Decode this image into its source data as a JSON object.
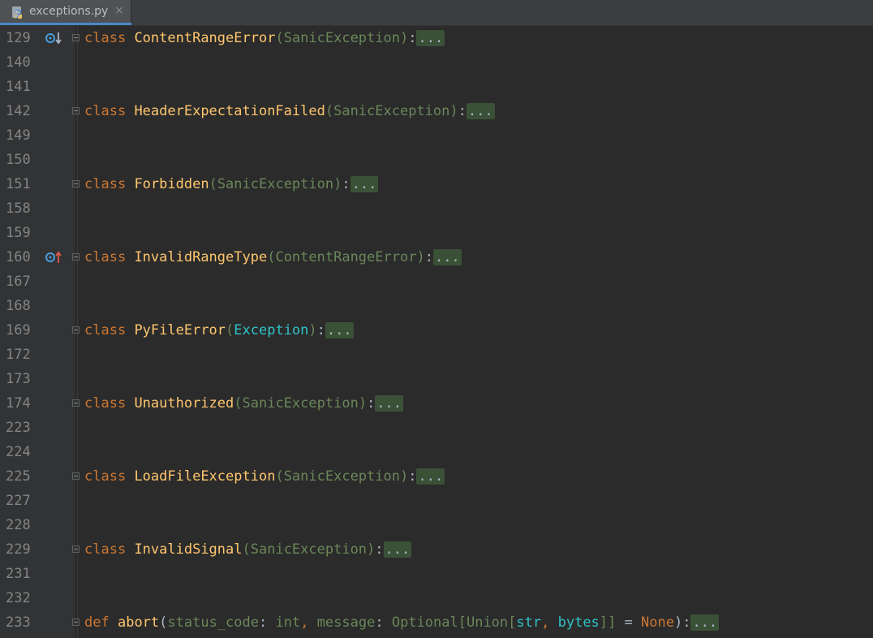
{
  "tab": {
    "filename": "exceptions.py",
    "icon": "python-file-icon",
    "close_glyph": "×"
  },
  "colors": {
    "background": "#2B2B2B",
    "gutter": "#313335",
    "keyword": "#CC7832",
    "class_name": "#FFC66D",
    "base_class": "#6A8759",
    "builtin_cyan": "#2FC4C8",
    "folded_bg": "#3B5137"
  },
  "lines": [
    {
      "number": "129",
      "marker": "override-down",
      "kind": "class",
      "keyword": "class",
      "name": "ContentRangeError",
      "base": "SanicException",
      "base_style": "base",
      "folded": "..."
    },
    {
      "number": "140"
    },
    {
      "number": "141"
    },
    {
      "number": "142",
      "kind": "class",
      "keyword": "class",
      "name": "HeaderExpectationFailed",
      "base": "SanicException",
      "base_style": "base",
      "folded": "..."
    },
    {
      "number": "149"
    },
    {
      "number": "150"
    },
    {
      "number": "151",
      "kind": "class",
      "keyword": "class",
      "name": "Forbidden",
      "base": "SanicException",
      "base_style": "base",
      "folded": "..."
    },
    {
      "number": "158"
    },
    {
      "number": "159"
    },
    {
      "number": "160",
      "marker": "override-up",
      "kind": "class",
      "keyword": "class",
      "name": "InvalidRangeType",
      "base": "ContentRangeError",
      "base_style": "base",
      "folded": "..."
    },
    {
      "number": "167"
    },
    {
      "number": "168"
    },
    {
      "number": "169",
      "kind": "class",
      "keyword": "class",
      "name": "PyFileError",
      "base": "Exception",
      "base_style": "cyan",
      "folded": "..."
    },
    {
      "number": "172"
    },
    {
      "number": "173"
    },
    {
      "number": "174",
      "kind": "class",
      "keyword": "class",
      "name": "Unauthorized",
      "base": "SanicException",
      "base_style": "base",
      "folded": "..."
    },
    {
      "number": "223"
    },
    {
      "number": "224"
    },
    {
      "number": "225",
      "kind": "class",
      "keyword": "class",
      "name": "LoadFileException",
      "base": "SanicException",
      "base_style": "base",
      "folded": "..."
    },
    {
      "number": "227"
    },
    {
      "number": "228"
    },
    {
      "number": "229",
      "kind": "class",
      "keyword": "class",
      "name": "InvalidSignal",
      "base": "SanicException",
      "base_style": "base",
      "folded": "..."
    },
    {
      "number": "231"
    },
    {
      "number": "232"
    },
    {
      "number": "233",
      "kind": "def",
      "keyword": "def",
      "name": "abort",
      "tokens": [
        {
          "t": "(",
          "s": "punct"
        },
        {
          "t": "status_code",
          "s": "base"
        },
        {
          "t": ": ",
          "s": "punct"
        },
        {
          "t": "int",
          "s": "base"
        },
        {
          "t": ", ",
          "s": "kw"
        },
        {
          "t": "message",
          "s": "base"
        },
        {
          "t": ": ",
          "s": "punct"
        },
        {
          "t": "Optional",
          "s": "base"
        },
        {
          "t": "[",
          "s": "base"
        },
        {
          "t": "Union",
          "s": "base"
        },
        {
          "t": "[",
          "s": "base"
        },
        {
          "t": "str",
          "s": "cyan"
        },
        {
          "t": ", ",
          "s": "kw"
        },
        {
          "t": "bytes",
          "s": "cyan"
        },
        {
          "t": "]]",
          "s": "base"
        },
        {
          "t": " = ",
          "s": "punct"
        },
        {
          "t": "None",
          "s": "none"
        },
        {
          "t": "):",
          "s": "punct"
        }
      ],
      "folded": "..."
    }
  ]
}
